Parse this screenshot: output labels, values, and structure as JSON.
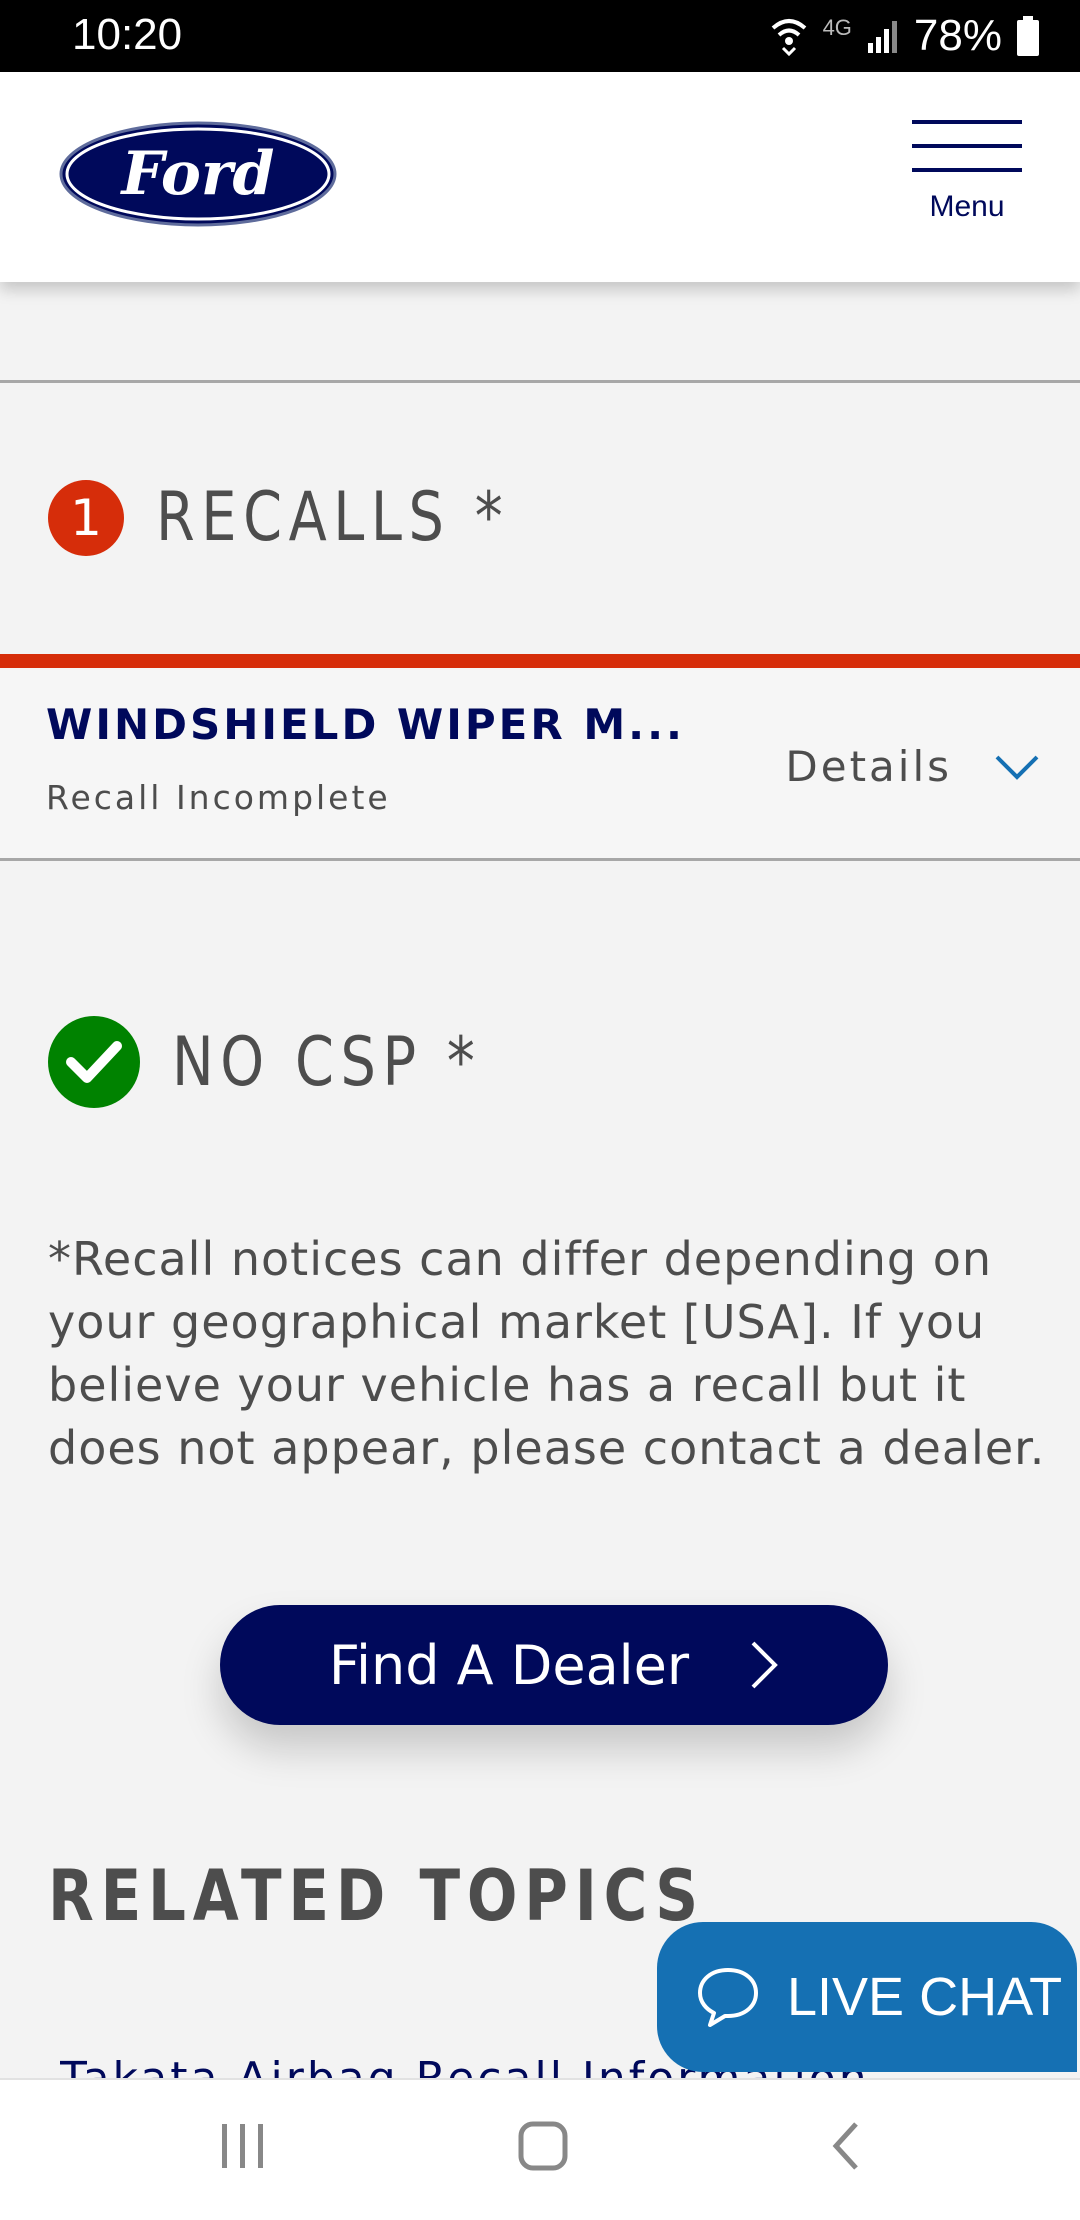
{
  "status_bar": {
    "time": "10:20",
    "network": "4G",
    "battery": "78%"
  },
  "header": {
    "logo": "Ford",
    "menu_label": "Menu"
  },
  "recalls": {
    "count": "1",
    "title": "RECALLS *",
    "items": [
      {
        "title": "WINDSHIELD WIPER M...",
        "status": "Recall Incomplete",
        "details_label": "Details"
      }
    ]
  },
  "csp": {
    "title": "NO CSP *"
  },
  "notice": "*Recall notices can differ depending on your geographical market [USA]. If you believe your vehicle has a recall but it does not appear, please contact a dealer.",
  "dealer_button": {
    "label": "Find A Dealer"
  },
  "related": {
    "title": "RELATED TOPICS",
    "links": [
      "Takata Airbag Recall Information"
    ]
  },
  "live_chat": {
    "label": "LIVE CHAT"
  },
  "colors": {
    "ford_blue": "#00095b",
    "recall_red": "#d62d0a",
    "ok_green": "#008200",
    "chat_blue": "#1570b3"
  }
}
